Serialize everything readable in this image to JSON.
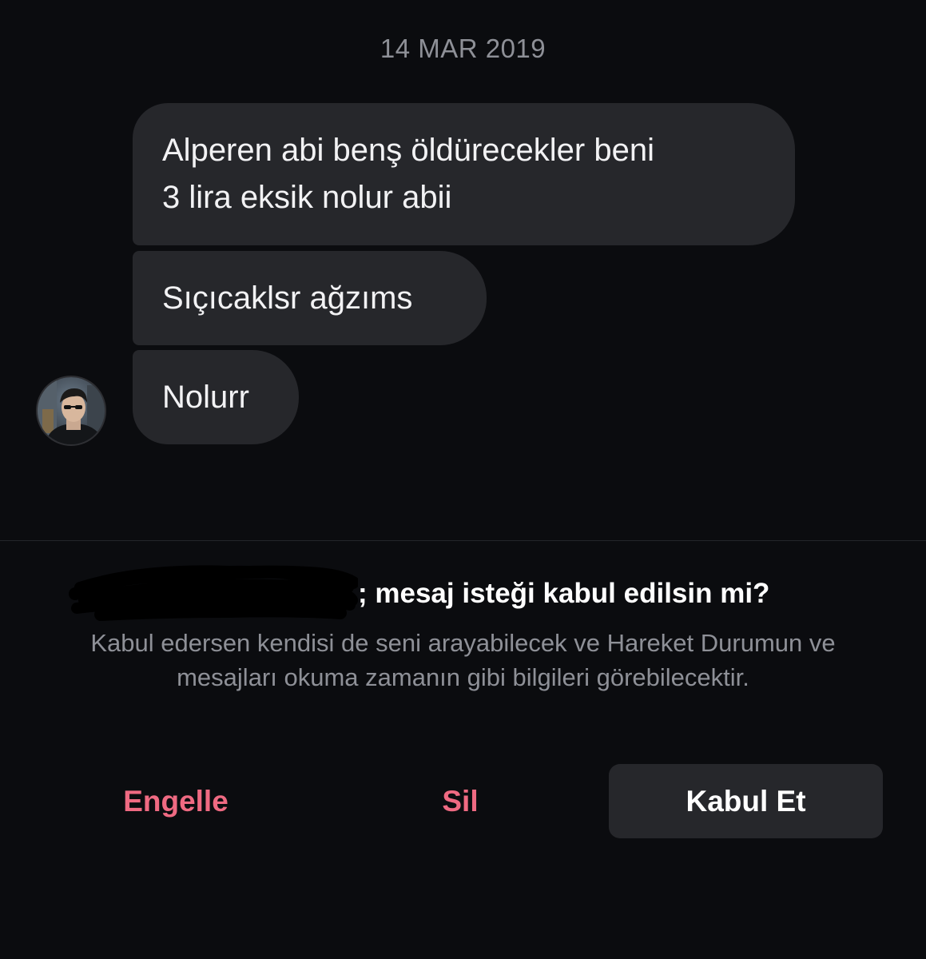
{
  "conversation": {
    "date_label": "14 MAR 2019",
    "messages": [
      {
        "lines": [
          "Alperen abi benş öldürecekler beni",
          "3 lira eksik nolur abii"
        ]
      },
      {
        "text": "Sıçıcaklsr ağzıms"
      },
      {
        "text": "Nolurr"
      }
    ],
    "sender_avatar": "profile-photo"
  },
  "request_prompt": {
    "sender_name_redacted": true,
    "title_suffix": "; mesaj isteği kabul edilsin mi?",
    "description": "Kabul edersen kendisi de seni arayabilecek ve Hareket Durumun ve mesajları okuma zamanın gibi bilgileri görebilecektir."
  },
  "actions": {
    "block_label": "Engelle",
    "delete_label": "Sil",
    "accept_label": "Kabul Et"
  },
  "colors": {
    "background": "#0b0c0f",
    "bubble": "#26272b",
    "destructive": "#ef6a82",
    "secondary_text": "#8e9097"
  }
}
